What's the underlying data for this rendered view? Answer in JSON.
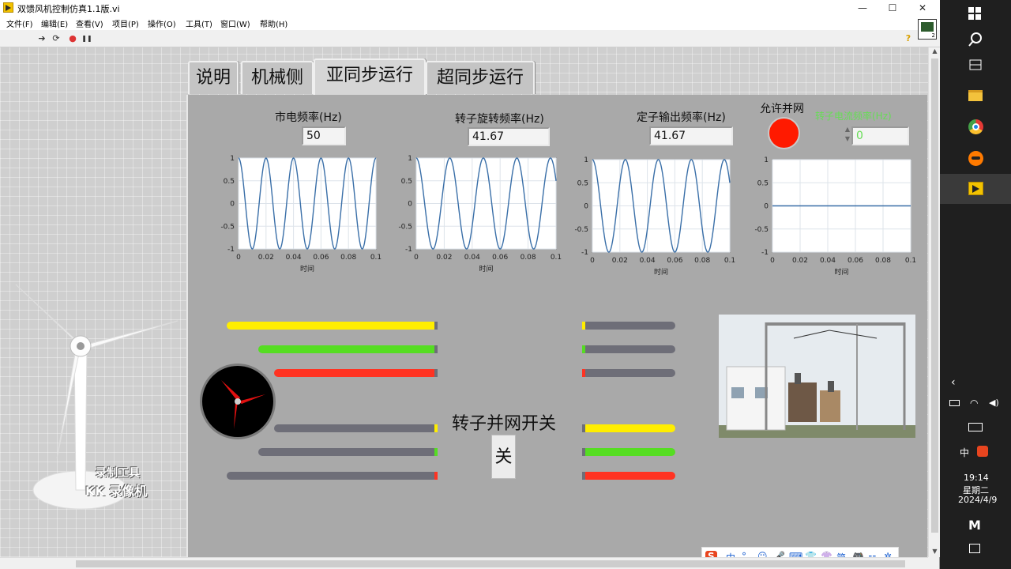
{
  "window": {
    "title": "双馈风机控制仿真1.1版.vi",
    "minimize": "—",
    "maximize": "☐",
    "close": "✕"
  },
  "menu": [
    "文件(F)",
    "编辑(E)",
    "查看(V)",
    "项目(P)",
    "操作(O)",
    "工具(T)",
    "窗口(W)",
    "帮助(H)"
  ],
  "toolbar": {
    "run_icon": "➔",
    "continuous_icon": "⟳",
    "abort_icon": "●",
    "pause_icon": "❚❚",
    "help_icon": "?",
    "vi_badge": "2"
  },
  "tabs": [
    "说明",
    "机械侧",
    "亚同步运行",
    "超同步运行"
  ],
  "active_tab": 2,
  "controls": {
    "grid_freq_label": "市电频率(Hz)",
    "grid_freq_value": "50",
    "rotor_freq_label": "转子旋转频率(Hz)",
    "rotor_freq_value": "41.67",
    "stator_freq_label": "定子输出频率(Hz)",
    "stator_freq_value": "41.67",
    "allow_grid_label": "允许并网",
    "rotor_current_label": "转子电流频率(Hz)",
    "rotor_current_value": "0",
    "switch_label": "转子并网开关",
    "switch_button": "关"
  },
  "chart_data": [
    {
      "type": "line",
      "x_label": "时间",
      "xlim": [
        0,
        0.1
      ],
      "ylim": [
        -1,
        1
      ],
      "x_ticks": [
        "0",
        "0.02",
        "0.04",
        "0.06",
        "0.08",
        "0.1"
      ],
      "y_ticks": [
        "1",
        "0.5",
        "0",
        "-0.5",
        "-1"
      ],
      "series": [
        {
          "function": "sin",
          "frequency_hz": 50,
          "color": "#3a6fa8"
        }
      ]
    },
    {
      "type": "line",
      "x_label": "时间",
      "xlim": [
        0,
        0.1
      ],
      "ylim": [
        -1,
        1
      ],
      "x_ticks": [
        "0",
        "0.02",
        "0.04",
        "0.06",
        "0.08",
        "0.1"
      ],
      "y_ticks": [
        "1",
        "0.5",
        "0",
        "-0.5",
        "-1"
      ],
      "series": [
        {
          "function": "sin",
          "frequency_hz": 41.67,
          "color": "#3a6fa8"
        }
      ]
    },
    {
      "type": "line",
      "x_label": "时间",
      "xlim": [
        0,
        0.1
      ],
      "ylim": [
        -1,
        1
      ],
      "x_ticks": [
        "0",
        "0.02",
        "0.04",
        "0.06",
        "0.08",
        "0.1"
      ],
      "y_ticks": [
        "1",
        "0.5",
        "0",
        "-0.5",
        "-1"
      ],
      "series": [
        {
          "function": "sin",
          "frequency_hz": 41.67,
          "color": "#3a6fa8"
        }
      ]
    },
    {
      "type": "line",
      "x_label": "时间",
      "xlim": [
        0,
        0.1
      ],
      "ylim": [
        -1,
        1
      ],
      "x_ticks": [
        "0",
        "0.02",
        "0.04",
        "0.06",
        "0.08",
        "0.1"
      ],
      "y_ticks": [
        "1",
        "0.5",
        "0",
        "-0.5",
        "-1"
      ],
      "series": [
        {
          "function": "zero",
          "frequency_hz": 0,
          "color": "#3a6fa8"
        }
      ]
    }
  ],
  "colors": {
    "yellow": "#ffee00",
    "green": "#55dd22",
    "red": "#ff3322",
    "gray": "#6e6e78",
    "led": "#ff1a00"
  },
  "watermark": [
    "录制工具",
    "KK 录像机"
  ],
  "ime_bar": [
    "S",
    "中",
    "°,",
    "☺",
    "🎤",
    "⌨",
    "👕",
    "👚",
    "简",
    "🎮",
    "⚏",
    "✲"
  ],
  "taskbar": {
    "ime_lang": "中",
    "time": "19:14",
    "weekday": "星期二",
    "date": "2024/4/9"
  }
}
